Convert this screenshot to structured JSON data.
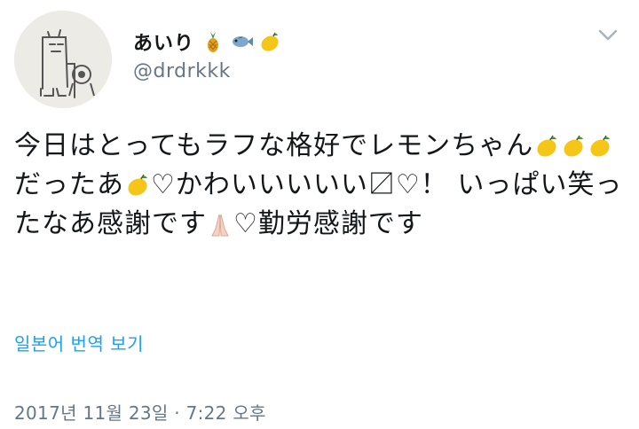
{
  "author": {
    "display_name": "あいり",
    "name_emoji": [
      "pineapple-icon",
      "fish-icon",
      "lemon-icon"
    ],
    "handle": "@drdrkkk"
  },
  "tweet": {
    "text_parts": [
      "今日はとってもラフな格好でレモンちゃん",
      "だったあ",
      "♡かわいいいいい",
      "〼♡！  いっぱい笑ったなあ感謝です",
      "♡勤労感謝です"
    ]
  },
  "translate_label": "일본어 번역 보기",
  "timestamp": "2017년 11월 23일 · 7:22 오후",
  "colors": {
    "text": "#14171a",
    "secondary": "#657786",
    "link": "#1da1f2"
  }
}
